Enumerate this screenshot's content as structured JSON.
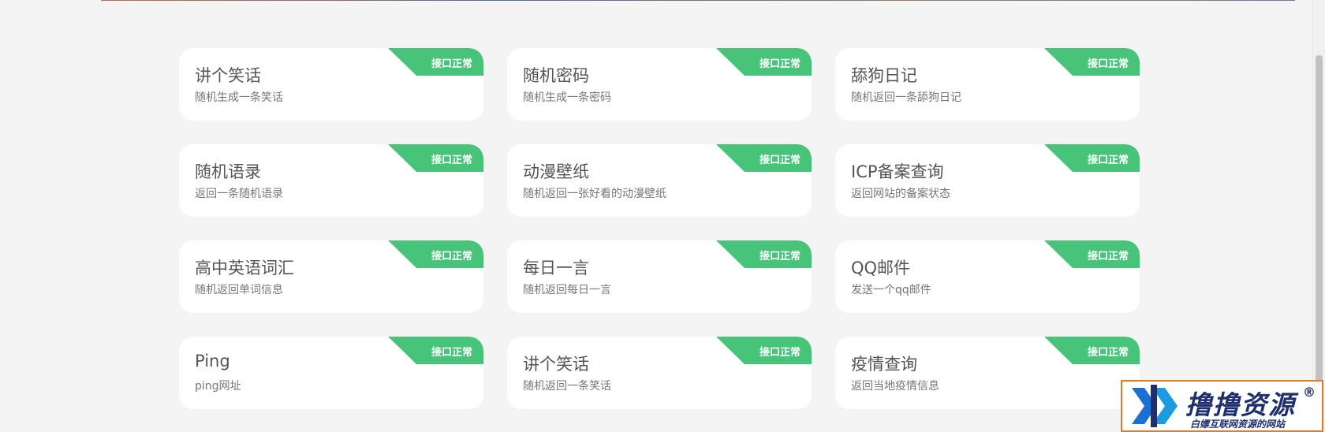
{
  "status_label": "接口正常",
  "colors": {
    "background": "#f4f4f4",
    "card": "#ffffff",
    "badge": "#48c37a",
    "title": "#555555",
    "description": "#777777"
  },
  "cards": [
    {
      "title": "讲个笑话",
      "desc": "随机生成一条笑话",
      "status": "接口正常"
    },
    {
      "title": "随机密码",
      "desc": "随机生成一条密码",
      "status": "接口正常"
    },
    {
      "title": "舔狗日记",
      "desc": "随机返回一条舔狗日记",
      "status": "接口正常"
    },
    {
      "title": "随机语录",
      "desc": "返回一条随机语录",
      "status": "接口正常"
    },
    {
      "title": "动漫壁纸",
      "desc": "随机返回一张好看的动漫壁纸",
      "status": "接口正常"
    },
    {
      "title": "ICP备案查询",
      "desc": "返回网站的备案状态",
      "status": "接口正常"
    },
    {
      "title": "高中英语词汇",
      "desc": "随机返回单词信息",
      "status": "接口正常"
    },
    {
      "title": "每日一言",
      "desc": "随机返回每日一言",
      "status": "接口正常"
    },
    {
      "title": "QQ邮件",
      "desc": "发送一个qq邮件",
      "status": "接口正常"
    },
    {
      "title": "Ping",
      "desc": "ping网址",
      "status": "接口正常"
    },
    {
      "title": "讲个笑话",
      "desc": "随机返回一条笑话",
      "status": "接口正常"
    },
    {
      "title": "疫情查询",
      "desc": "返回当地疫情信息",
      "status": "接口正常"
    }
  ],
  "watermark": {
    "title": "撸撸资源",
    "registered": "®",
    "subtitle": "白嫖互联网资源的网站",
    "logo_icon": "blue-chevron-logo"
  }
}
